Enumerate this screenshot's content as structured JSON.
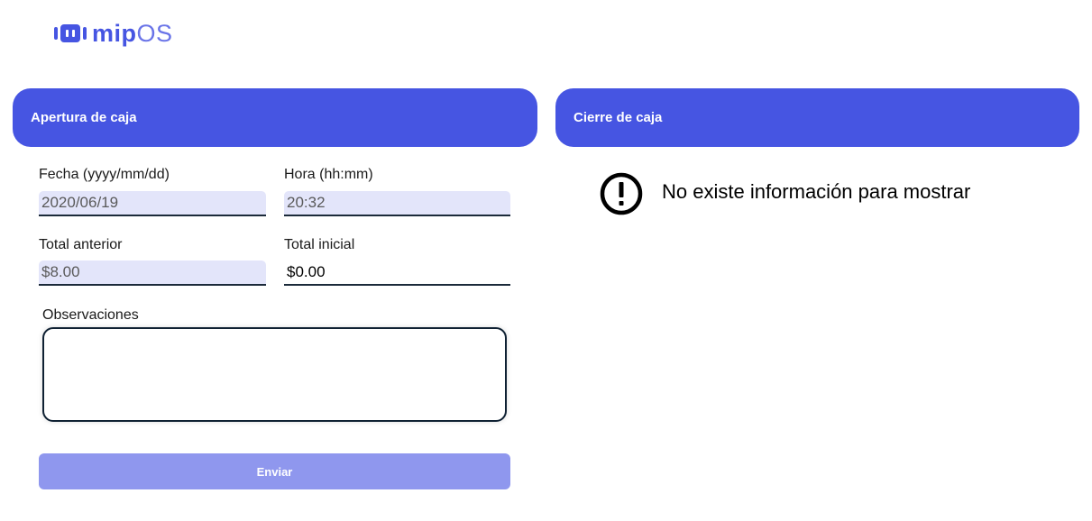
{
  "brand": {
    "name_bold": "mip",
    "name_light": "OS",
    "color": "#4655e2"
  },
  "opening": {
    "title": "Apertura de caja",
    "fecha": {
      "label": "Fecha (yyyy/mm/dd)",
      "value": "2020/06/19"
    },
    "hora": {
      "label": "Hora (hh:mm)",
      "value": "20:32"
    },
    "total_anterior": {
      "label": "Total anterior",
      "value": "$8.00"
    },
    "total_inicial": {
      "label": "Total inicial",
      "value": "$0.00"
    },
    "observaciones": {
      "label": "Observaciones",
      "value": ""
    },
    "submit_label": "Enviar"
  },
  "closing": {
    "title": "Cierre de caja",
    "empty_icon": "alert-circle-icon",
    "empty_message": "No existe información para mostrar"
  }
}
